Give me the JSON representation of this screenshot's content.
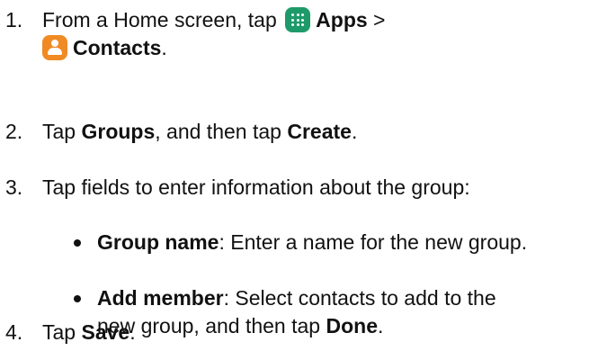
{
  "steps": [
    {
      "number": "1.",
      "pre": "From a Home screen, tap ",
      "apps_label": "Apps",
      "sep": " >",
      "contacts_label": "Contacts",
      "end": "."
    },
    {
      "number": "2.",
      "pre": "Tap ",
      "groups_label": "Groups",
      "mid": ", and then tap ",
      "create_label": "Create",
      "end": "."
    },
    {
      "number": "3.",
      "text": "Tap fields to enter information about the group:",
      "bullets": [
        {
          "label": "Group name",
          "text": ": Enter a name for the new group."
        },
        {
          "label": "Add member",
          "text_line1": ": Select contacts to add to the",
          "text_line2_pre": "new group, and then tap ",
          "done_label": "Done",
          "end": "."
        }
      ]
    },
    {
      "number": "4.",
      "pre": "Tap ",
      "save_label": "Save",
      "end": "."
    }
  ],
  "icons": {
    "apps": "apps-grid-icon",
    "contacts": "contacts-person-icon"
  },
  "colors": {
    "apps_icon": "#1e9a6a",
    "contacts_icon": "#f08a24",
    "text": "#111111"
  }
}
